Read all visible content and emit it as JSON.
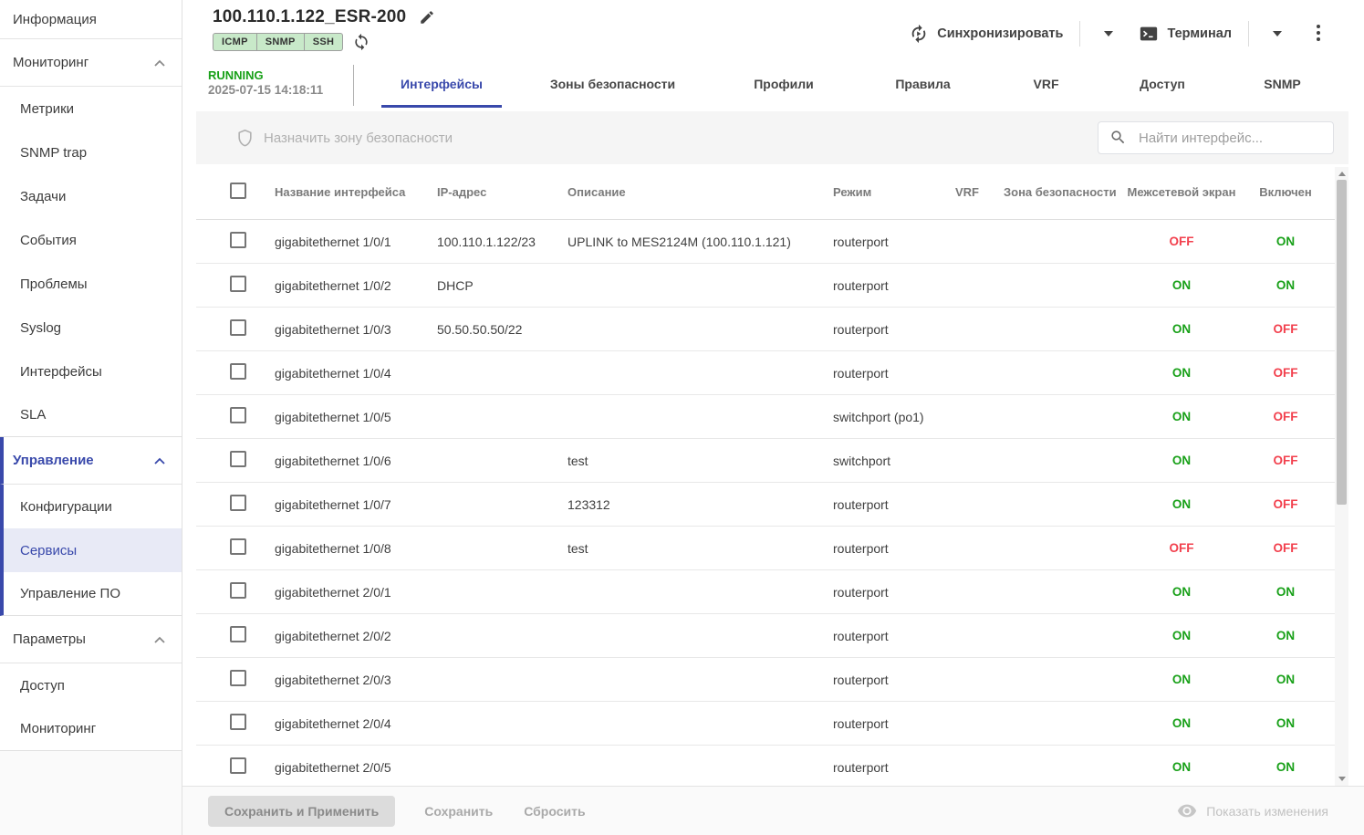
{
  "colors": {
    "accent": "#3949ab",
    "green": "#18a018",
    "red": "#f2414e",
    "badge_bg": "#c8e9c9"
  },
  "sidebar": {
    "items": [
      {
        "label": "Информация",
        "kind": "top"
      },
      {
        "label": "Мониторинг",
        "kind": "section"
      },
      {
        "label": "Метрики",
        "kind": "sub"
      },
      {
        "label": "SNMP trap",
        "kind": "sub"
      },
      {
        "label": "Задачи",
        "kind": "sub"
      },
      {
        "label": "События",
        "kind": "sub"
      },
      {
        "label": "Проблемы",
        "kind": "sub"
      },
      {
        "label": "Syslog",
        "kind": "sub"
      },
      {
        "label": "Интерфейсы",
        "kind": "sub"
      },
      {
        "label": "SLA",
        "kind": "sub",
        "divider_after": true
      },
      {
        "label": "Управление",
        "kind": "section",
        "active": true,
        "group": true
      },
      {
        "label": "Конфигурации",
        "kind": "sub",
        "group": true
      },
      {
        "label": "Сервисы",
        "kind": "sub",
        "group": true,
        "selected": true
      },
      {
        "label": "Управление ПО",
        "kind": "sub",
        "group": true,
        "divider_after": true
      },
      {
        "label": "Параметры",
        "kind": "section"
      },
      {
        "label": "Доступ",
        "kind": "sub"
      },
      {
        "label": "Мониторинг",
        "kind": "sub",
        "divider_after": true
      }
    ]
  },
  "header": {
    "title": "100.110.1.122_ESR-200",
    "badges": [
      "ICMP",
      "SNMP",
      "SSH"
    ],
    "sync_label": "Синхронизировать",
    "terminal_label": "Терминал"
  },
  "status": {
    "state": "RUNNING",
    "timestamp": "2025-07-15 14:18:11"
  },
  "tabs": [
    {
      "label": "Интерфейсы",
      "active": true
    },
    {
      "label": "Зоны безопасности"
    },
    {
      "label": "Профили"
    },
    {
      "label": "Правила"
    },
    {
      "label": "VRF"
    },
    {
      "label": "Доступ"
    },
    {
      "label": "SNMP"
    }
  ],
  "toolbar": {
    "assign_zone_label": "Назначить зону безопасности",
    "search_placeholder": "Найти интерфейс..."
  },
  "table": {
    "columns": [
      "Название интерфейса",
      "IP-адрес",
      "Описание",
      "Режим",
      "VRF",
      "Зона безопасности",
      "Межсетевой экран",
      "Включен"
    ],
    "rows": [
      {
        "name": "gigabitethernet 1/0/1",
        "ip": "100.110.1.122/23",
        "description": "UPLINK to MES2124M (100.110.1.121)",
        "mode": "routerport",
        "vrf": "",
        "zone": "",
        "firewall": "OFF",
        "enabled": "ON"
      },
      {
        "name": "gigabitethernet 1/0/2",
        "ip": "DHCP",
        "description": "",
        "mode": "routerport",
        "vrf": "",
        "zone": "",
        "firewall": "ON",
        "enabled": "ON"
      },
      {
        "name": "gigabitethernet 1/0/3",
        "ip": "50.50.50.50/22",
        "description": "",
        "mode": "routerport",
        "vrf": "",
        "zone": "",
        "firewall": "ON",
        "enabled": "OFF"
      },
      {
        "name": "gigabitethernet 1/0/4",
        "ip": "",
        "description": "",
        "mode": "routerport",
        "vrf": "",
        "zone": "",
        "firewall": "ON",
        "enabled": "OFF"
      },
      {
        "name": "gigabitethernet 1/0/5",
        "ip": "",
        "description": "",
        "mode": "switchport (po1)",
        "vrf": "",
        "zone": "",
        "firewall": "ON",
        "enabled": "OFF"
      },
      {
        "name": "gigabitethernet 1/0/6",
        "ip": "",
        "description": "test",
        "mode": "switchport",
        "vrf": "",
        "zone": "",
        "firewall": "ON",
        "enabled": "OFF"
      },
      {
        "name": "gigabitethernet 1/0/7",
        "ip": "",
        "description": "123312",
        "mode": "routerport",
        "vrf": "",
        "zone": "",
        "firewall": "ON",
        "enabled": "OFF"
      },
      {
        "name": "gigabitethernet 1/0/8",
        "ip": "",
        "description": "test",
        "mode": "routerport",
        "vrf": "",
        "zone": "",
        "firewall": "OFF",
        "enabled": "OFF"
      },
      {
        "name": "gigabitethernet 2/0/1",
        "ip": "",
        "description": "",
        "mode": "routerport",
        "vrf": "",
        "zone": "",
        "firewall": "ON",
        "enabled": "ON"
      },
      {
        "name": "gigabitethernet 2/0/2",
        "ip": "",
        "description": "",
        "mode": "routerport",
        "vrf": "",
        "zone": "",
        "firewall": "ON",
        "enabled": "ON"
      },
      {
        "name": "gigabitethernet 2/0/3",
        "ip": "",
        "description": "",
        "mode": "routerport",
        "vrf": "",
        "zone": "",
        "firewall": "ON",
        "enabled": "ON"
      },
      {
        "name": "gigabitethernet 2/0/4",
        "ip": "",
        "description": "",
        "mode": "routerport",
        "vrf": "",
        "zone": "",
        "firewall": "ON",
        "enabled": "ON"
      },
      {
        "name": "gigabitethernet 2/0/5",
        "ip": "",
        "description": "",
        "mode": "routerport",
        "vrf": "",
        "zone": "",
        "firewall": "ON",
        "enabled": "ON"
      }
    ]
  },
  "footer": {
    "save_apply_label": "Сохранить и Применить",
    "save_label": "Сохранить",
    "reset_label": "Сбросить",
    "show_changes_label": "Показать изменения"
  }
}
